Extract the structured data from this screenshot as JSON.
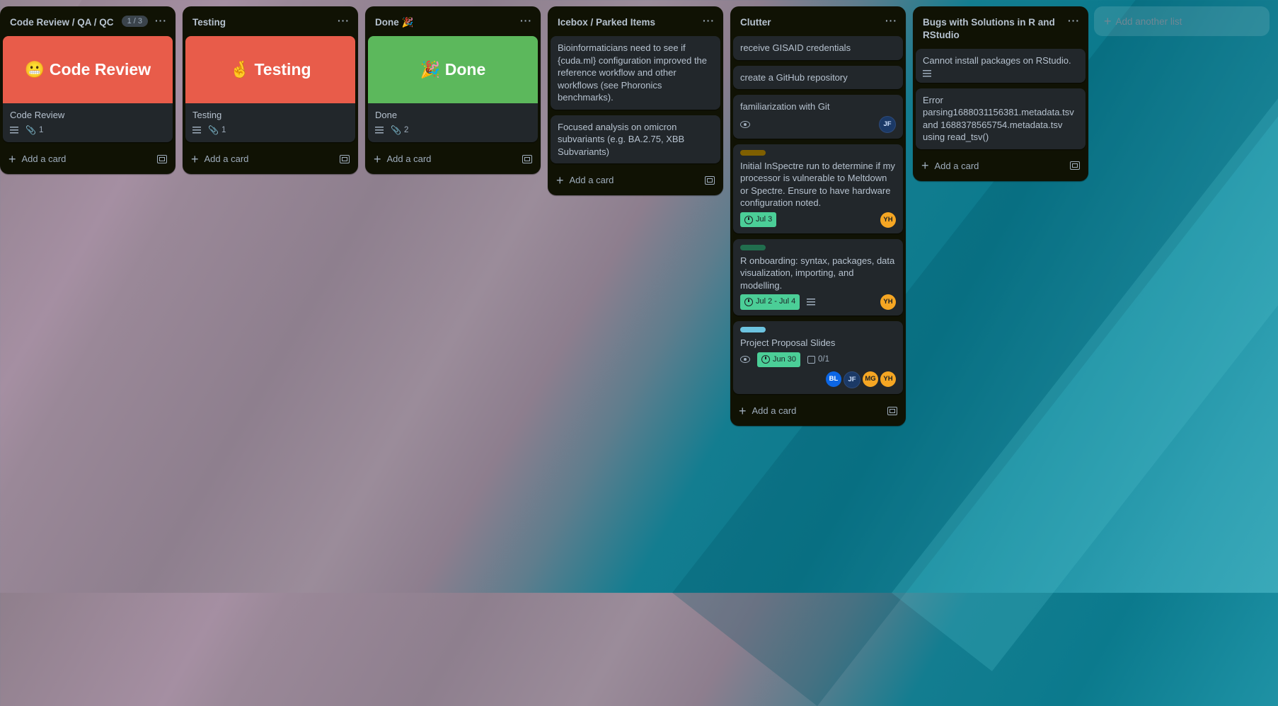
{
  "lists": [
    {
      "title": "Code Review / QA / QC",
      "count": "1 / 3",
      "cards": [
        {
          "cover_text": "😬 Code Review",
          "cover_color": "#e85c4a",
          "title": "Code Review",
          "attachments": "1"
        }
      ],
      "add_card_label": "Add a card"
    },
    {
      "title": "Testing",
      "cards": [
        {
          "cover_text": "🤞 Testing",
          "cover_color": "#e85c4a",
          "title": "Testing",
          "attachments": "1"
        }
      ],
      "add_card_label": "Add a card"
    },
    {
      "title": "Done 🎉",
      "cards": [
        {
          "cover_text": "🎉 Done",
          "cover_color": "#5cb85c",
          "title": "Done",
          "attachments": "2"
        }
      ],
      "add_card_label": "Add a card"
    },
    {
      "title": "Icebox / Parked Items",
      "cards": [
        {
          "title": "Bioinformaticians need to see if {cuda.ml} configuration improved the reference workflow and other workflows (see Phoronics benchmarks)."
        },
        {
          "title": "Focused analysis on omicron subvariants (e.g. BA.2.75, XBB Subvariants)"
        }
      ],
      "add_card_label": "Add a card"
    },
    {
      "title": "Clutter",
      "cards": [
        {
          "title": "receive GISAID credentials"
        },
        {
          "title": "create a GitHub repository"
        },
        {
          "title": "familiarization with Git",
          "members": [
            "JF"
          ]
        },
        {
          "label_color": "#7f5f01",
          "title": "Initial InSpectre run to determine if my processor is vulnerable to Meltdown or Spectre. Ensure to have hardware configuration noted.",
          "date": "Jul 3",
          "members": [
            "YH"
          ]
        },
        {
          "label_color": "#216e4e",
          "title": "R onboarding: syntax, packages, data visualization, importing, and modelling.",
          "date": "Jul 2 - Jul 4",
          "members": [
            "YH"
          ]
        },
        {
          "label_color": "#6cc3e0",
          "title": "Project Proposal Slides",
          "date": "Jun 30",
          "checklist": "0/1",
          "members": [
            "BL",
            "JF",
            "MG",
            "YH"
          ]
        }
      ],
      "add_card_label": "Add a card"
    },
    {
      "title": "Bugs with Solutions in R and RStudio",
      "cards": [
        {
          "title": "Cannot install packages on RStudio."
        },
        {
          "title": "Error parsing1688031156381.metadata.tsv and 1688378565754.metadata.tsv using read_tsv()"
        }
      ],
      "add_card_label": "Add a card"
    }
  ],
  "add_list_label": "Add another list"
}
